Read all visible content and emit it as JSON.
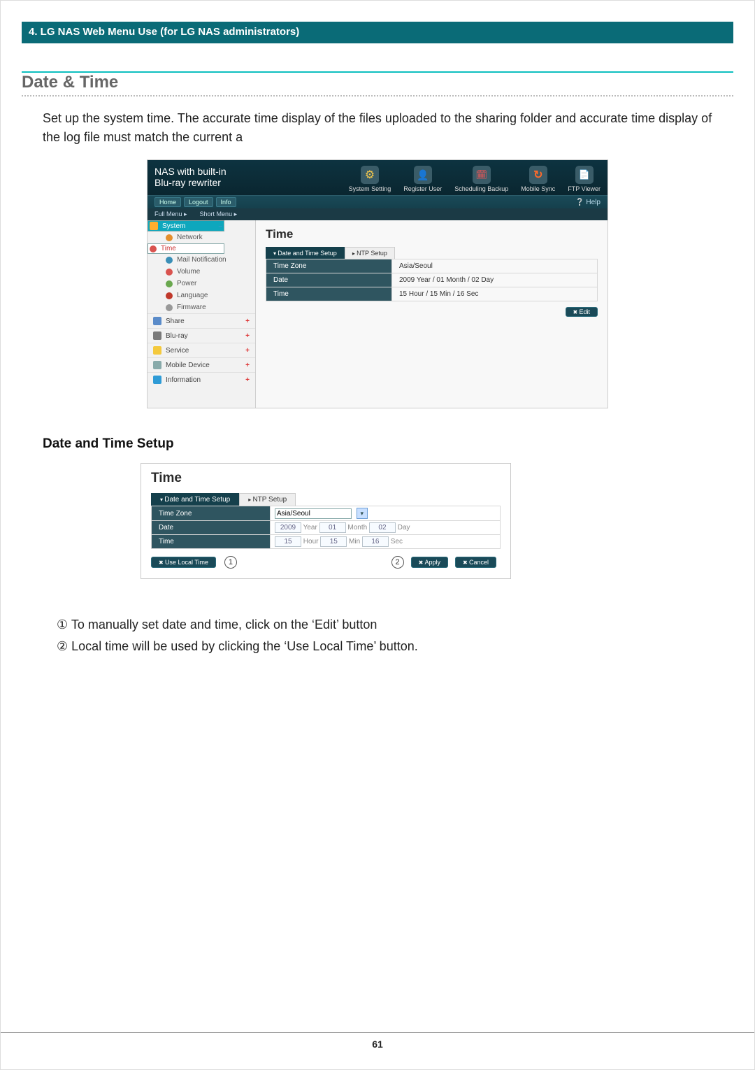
{
  "doc": {
    "chapter": "4. LG NAS Web Menu Use (for LG NAS administrators)",
    "title": "Date & Time",
    "intro": "Set up the system time. The accurate time display of the files uploaded to the sharing folder and accurate time display of the log file must match the current a",
    "sub_heading": "Date and Time Setup",
    "page_number": "61"
  },
  "shot1": {
    "product": "NAS with built-in\nBlu-ray rewriter",
    "top_icons": [
      {
        "label": "System Setting",
        "name": "system-setting-icon",
        "cls": "gear"
      },
      {
        "label": "Register User",
        "name": "register-user-icon",
        "cls": "user"
      },
      {
        "label": "Scheduling Backup",
        "name": "scheduling-backup-icon",
        "cls": "clock"
      },
      {
        "label": "Mobile Sync",
        "name": "mobile-sync-icon",
        "cls": "sync"
      },
      {
        "label": "FTP Viewer",
        "name": "ftp-viewer-icon",
        "cls": "ftp"
      }
    ],
    "nav": {
      "home": "Home",
      "logout": "Logout",
      "info": "Info",
      "help": "Help"
    },
    "menu_mode": {
      "full": "Full Menu ▸",
      "short": "Short Menu ▸"
    },
    "sidebar": {
      "categories": [
        {
          "label": "System",
          "expanded": true,
          "items": [
            {
              "label": "Network",
              "ic": "#e48f2e"
            },
            {
              "label": "Time",
              "ic": "#d9534f",
              "selected": true
            },
            {
              "label": "Mail Notification",
              "ic": "#3a8fb7"
            },
            {
              "label": "Volume",
              "ic": "#d9534f"
            },
            {
              "label": "Power",
              "ic": "#6aa84f"
            },
            {
              "label": "Language",
              "ic": "#c0392b"
            },
            {
              "label": "Firmware",
              "ic": "#999999"
            }
          ]
        },
        {
          "label": "Share"
        },
        {
          "label": "Blu-ray"
        },
        {
          "label": "Service"
        },
        {
          "label": "Mobile Device"
        },
        {
          "label": "Information"
        }
      ]
    },
    "content": {
      "heading": "Time",
      "tabs": {
        "active": "Date and Time Setup",
        "inactive": "NTP Setup"
      },
      "rows": {
        "tz_label": "Time Zone",
        "tz_value": "Asia/Seoul",
        "date_label": "Date",
        "date_value": "2009 Year / 01 Month / 02 Day",
        "time_label": "Time",
        "time_value": "15 Hour / 15 Min / 16 Sec"
      },
      "edit_btn": "Edit"
    }
  },
  "shot2": {
    "heading": "Time",
    "tabs": {
      "active": "Date and Time Setup",
      "inactive": "NTP Setup"
    },
    "rows": {
      "tz_label": "Time Zone",
      "tz_value": "Asia/Seoul",
      "date_label": "Date",
      "year": "2009",
      "year_lbl": "Year",
      "month": "01",
      "month_lbl": "Month",
      "day": "02",
      "day_lbl": "Day",
      "time_label": "Time",
      "hour": "15",
      "hour_lbl": "Hour",
      "min": "15",
      "min_lbl": "Min",
      "sec": "16",
      "sec_lbl": "Sec"
    },
    "buttons": {
      "use_local": "Use Local Time",
      "apply": "Apply",
      "cancel": "Cancel"
    },
    "callouts": {
      "one": "1",
      "two": "2"
    }
  },
  "list": {
    "item1_num": "①",
    "item1": "To manually set date and time, click on the ‘Edit’ button",
    "item2_num": "②",
    "item2": "Local time will be used by clicking the ‘Use Local Time’ button."
  }
}
